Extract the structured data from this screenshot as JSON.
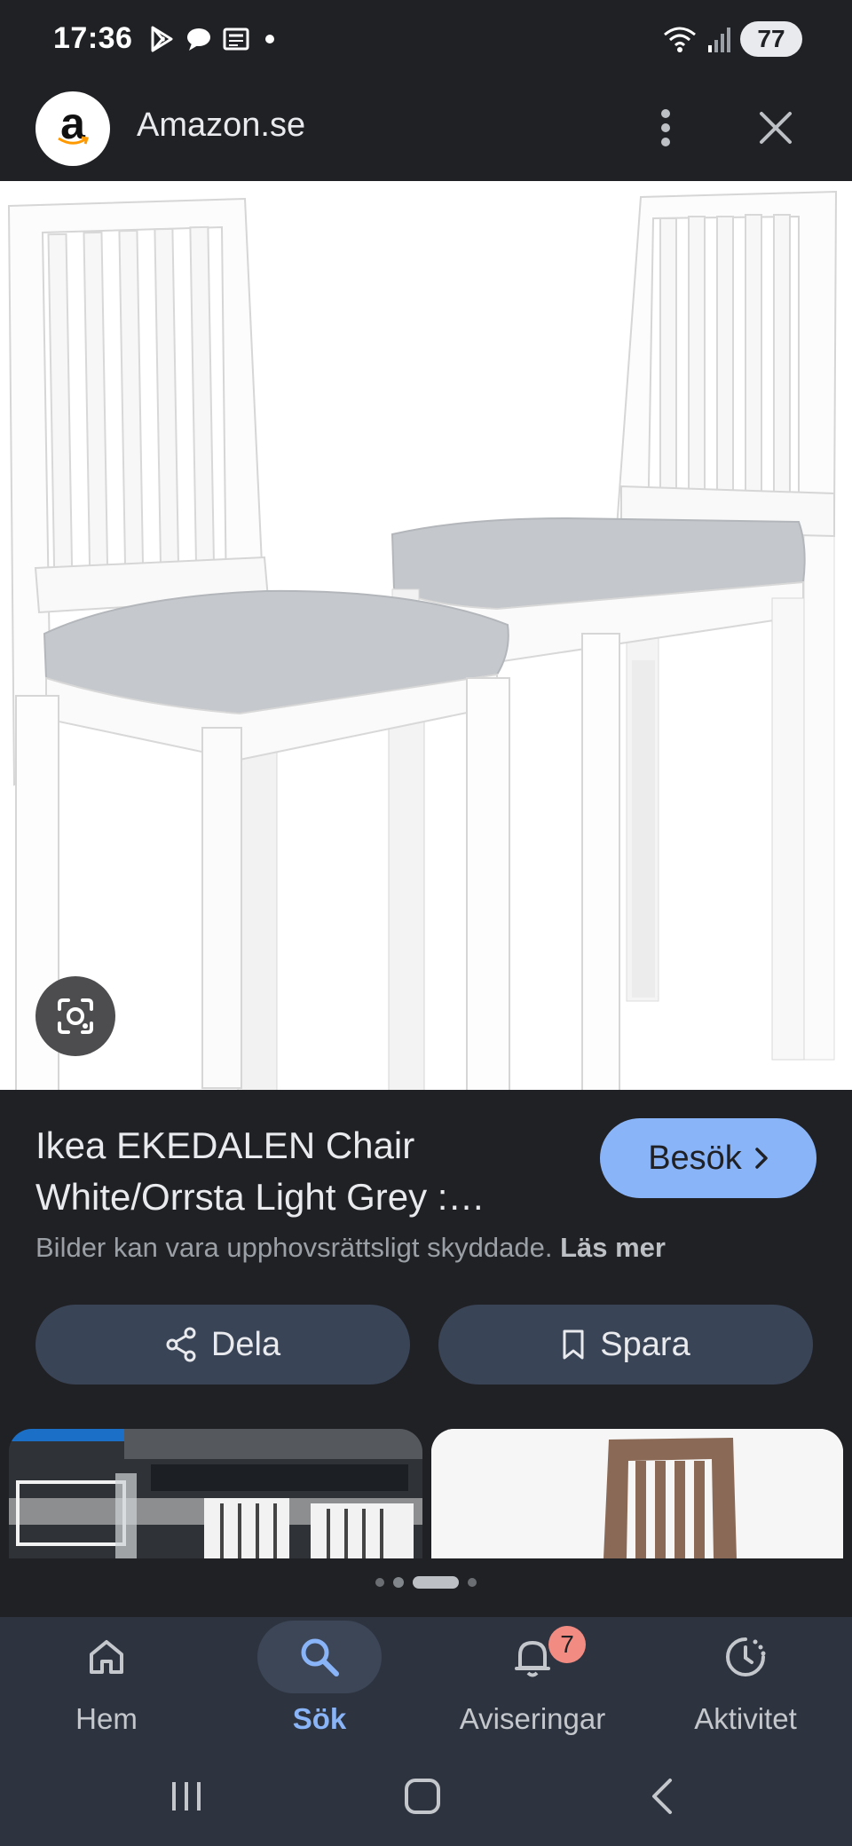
{
  "status_bar": {
    "time": "17:36",
    "battery": "77",
    "left_icons": [
      "play-store-icon",
      "chat-bubble-icon",
      "news-icon",
      "notification-dot-icon"
    ],
    "right_icons": [
      "wifi-icon",
      "signal-icon",
      "battery-icon"
    ]
  },
  "header": {
    "logo_letter": "a",
    "site_name": "Amazon.se",
    "menu_icon": "more-vert-icon",
    "close_icon": "close-icon"
  },
  "result": {
    "title": "Ikea EKEDALEN Chair White/Orrsta Light Grey :…",
    "visit_label": "Besök",
    "copyright_text": "Bilder kan vara upphovsrättsligt skyddade.",
    "copyright_more": "Läs mer"
  },
  "actions": {
    "share_label": "Dela",
    "save_label": "Spara"
  },
  "pager": {
    "count": 4,
    "active_index": 2
  },
  "bottom_nav": {
    "items": [
      {
        "label": "Hem",
        "icon": "home-icon"
      },
      {
        "label": "Sök",
        "icon": "search-icon",
        "active": true
      },
      {
        "label": "Aviseringar",
        "icon": "bell-icon",
        "badge": "7"
      },
      {
        "label": "Aktivitet",
        "icon": "history-icon"
      }
    ]
  },
  "colors": {
    "background": "#202124",
    "accent": "#8ab4f8",
    "button_bg": "#394457",
    "nav_bg": "#2d3440",
    "badge": "#f28b82"
  }
}
